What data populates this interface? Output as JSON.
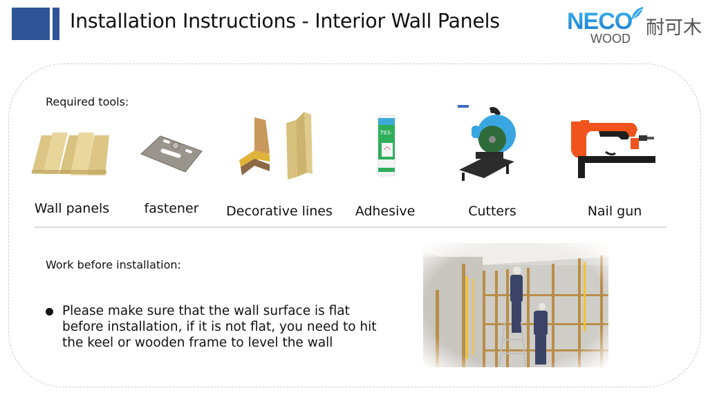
{
  "header": {
    "title": "Installation Instructions - Interior Wall Panels",
    "accent_color": "#2f5597"
  },
  "logo": {
    "brand_top": "NECO",
    "brand_bottom": "WOOD",
    "brand_cn": "耐可木",
    "icon": "leaf-icon",
    "brand_color": "#1e88d8"
  },
  "required_tools": {
    "label": "Required tools:",
    "items": [
      {
        "label": "Wall panels",
        "icon": "wall-panels-image"
      },
      {
        "label": "fastener",
        "icon": "fastener-image"
      },
      {
        "label": "Decorative lines",
        "icon": "decorative-lines-image"
      },
      {
        "label": "Adhesive",
        "icon": "adhesive-tube-image",
        "tube_text": "793-"
      },
      {
        "label": "Cutters",
        "icon": "cutter-saw-image"
      },
      {
        "label": "Nail gun",
        "icon": "nail-gun-image"
      }
    ]
  },
  "work_before": {
    "label": "Work before installation:",
    "bullets": [
      "Please make sure that the wall surface is flat before installation, if it is not flat, you need to hit the keel or wooden frame to level the wall"
    ],
    "photo": "workers-installing-keel-frame-photo"
  }
}
